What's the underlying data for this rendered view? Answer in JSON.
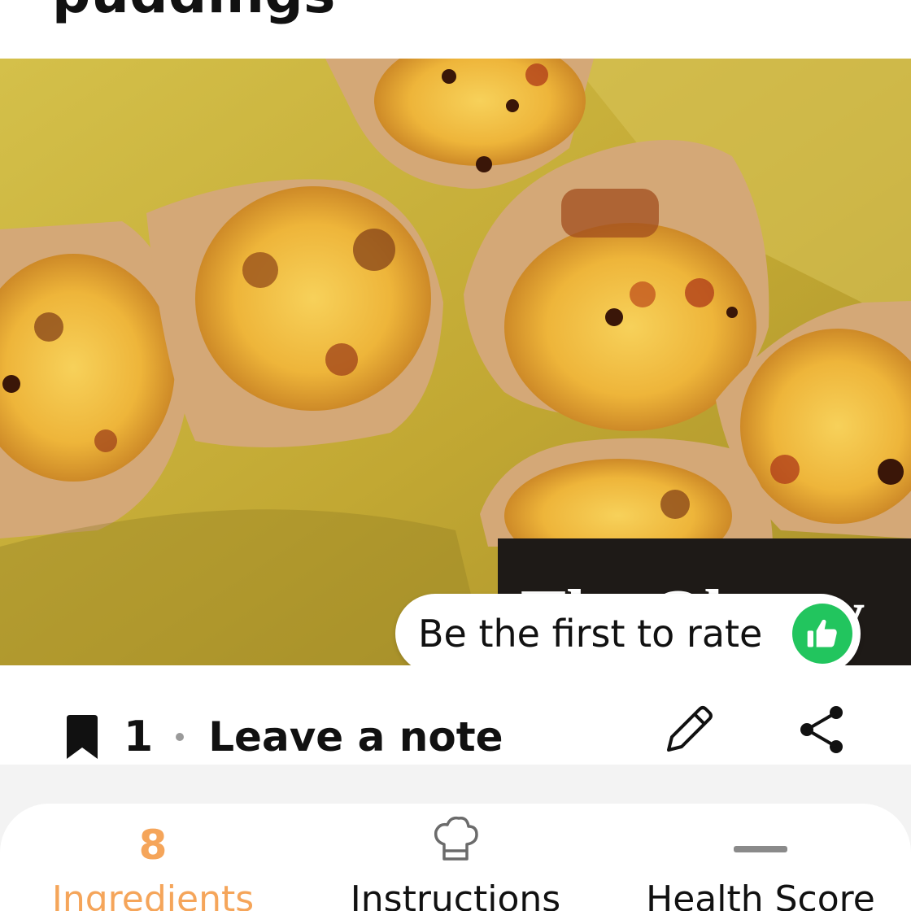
{
  "recipe": {
    "title": "puddings"
  },
  "hero": {
    "image_description_icon": "bread-pudding-photo",
    "watermark_text": "The Observ",
    "rating_prompt": "Be the first to rate",
    "rating_icon": "thumbs-up-icon",
    "rating_icon_color": "#22c55e"
  },
  "actions": {
    "save_count": "1",
    "note_label": "Leave a note",
    "edit_icon": "pencil-icon",
    "share_icon": "share-icon"
  },
  "tabs": [
    {
      "label": "Ingredients",
      "count": "8",
      "active": true
    },
    {
      "label": "Instructions",
      "icon": "chef-hat-icon",
      "active": false
    },
    {
      "label": "Health Score",
      "icon": "dash-icon",
      "active": false
    }
  ],
  "colors": {
    "accent": "#f5a55a",
    "background_paper": "#c8b03a",
    "text": "#111111"
  }
}
